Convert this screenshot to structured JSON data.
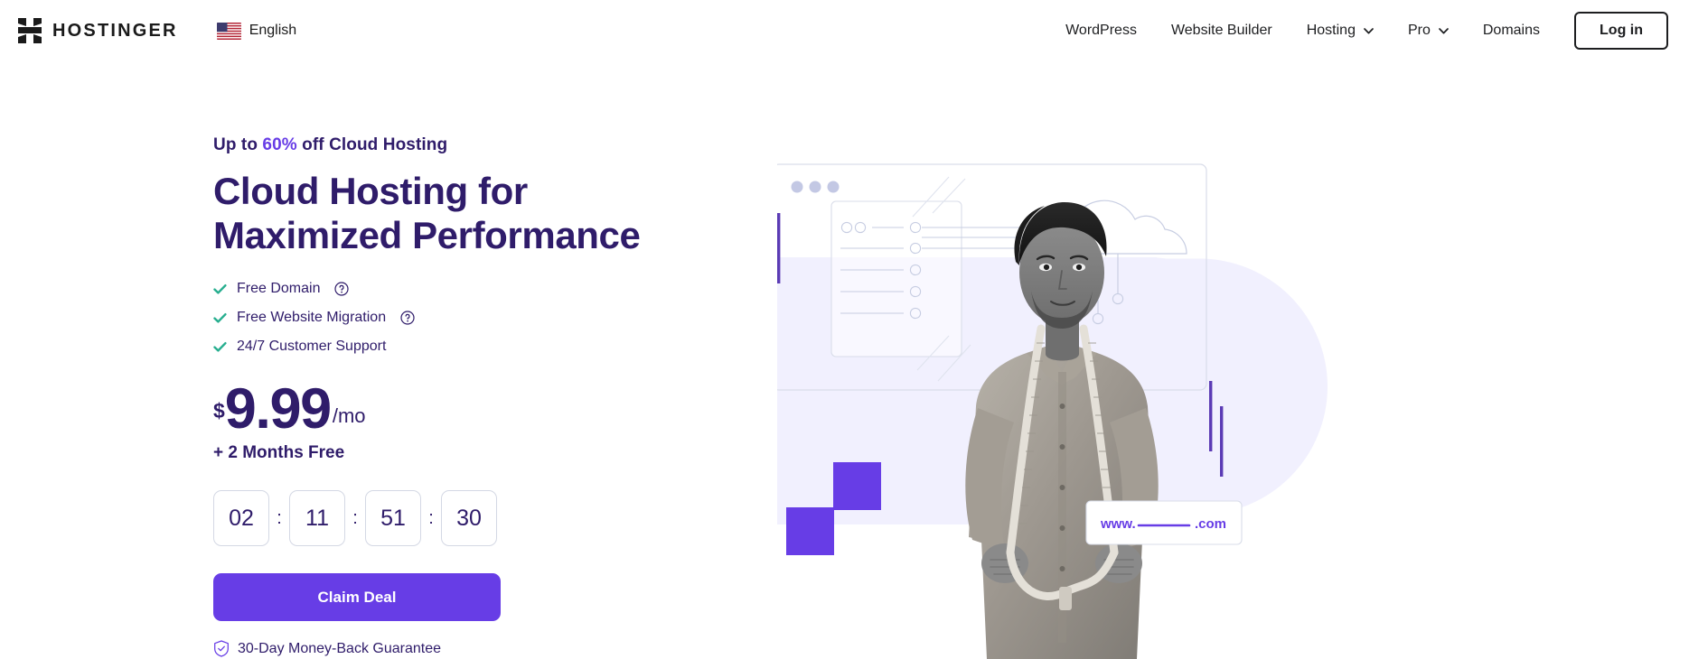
{
  "header": {
    "brand_name": "HOSTINGER",
    "language": "English",
    "nav_items": [
      {
        "label": "WordPress",
        "has_dropdown": false
      },
      {
        "label": "Website Builder",
        "has_dropdown": false
      },
      {
        "label": "Hosting",
        "has_dropdown": true
      },
      {
        "label": "Pro",
        "has_dropdown": true
      },
      {
        "label": "Domains",
        "has_dropdown": false
      }
    ],
    "login_label": "Log in"
  },
  "hero": {
    "eyebrow_pre": "Up to ",
    "eyebrow_percent": "60%",
    "eyebrow_post": " off Cloud Hosting",
    "headline_line1": "Cloud Hosting for",
    "headline_line2": "Maximized Performance",
    "features": [
      {
        "label": "Free Domain",
        "has_tooltip": true
      },
      {
        "label": "Free Website Migration",
        "has_tooltip": true
      },
      {
        "label": "24/7 Customer Support",
        "has_tooltip": false
      }
    ],
    "price": {
      "currency": "$",
      "amount": "9.99",
      "period": "/mo",
      "bonus": "+ 2 Months Free"
    },
    "timer": {
      "days": "02",
      "hours": "11",
      "minutes": "51",
      "seconds": "30",
      "separator": ":"
    },
    "cta_label": "Claim Deal",
    "guarantee_label": "30-Day Money-Back Guarantee"
  },
  "illustration": {
    "url_prefix": "www.",
    "url_suffix": ".com"
  },
  "colors": {
    "brand_purple": "#673DE6",
    "deep_indigo": "#2F1C6A",
    "check_teal": "#27AE8F",
    "lavender_bg": "#F1F0FE",
    "line_gray": "#D4D8E4",
    "text_dark": "#1D1E20"
  }
}
